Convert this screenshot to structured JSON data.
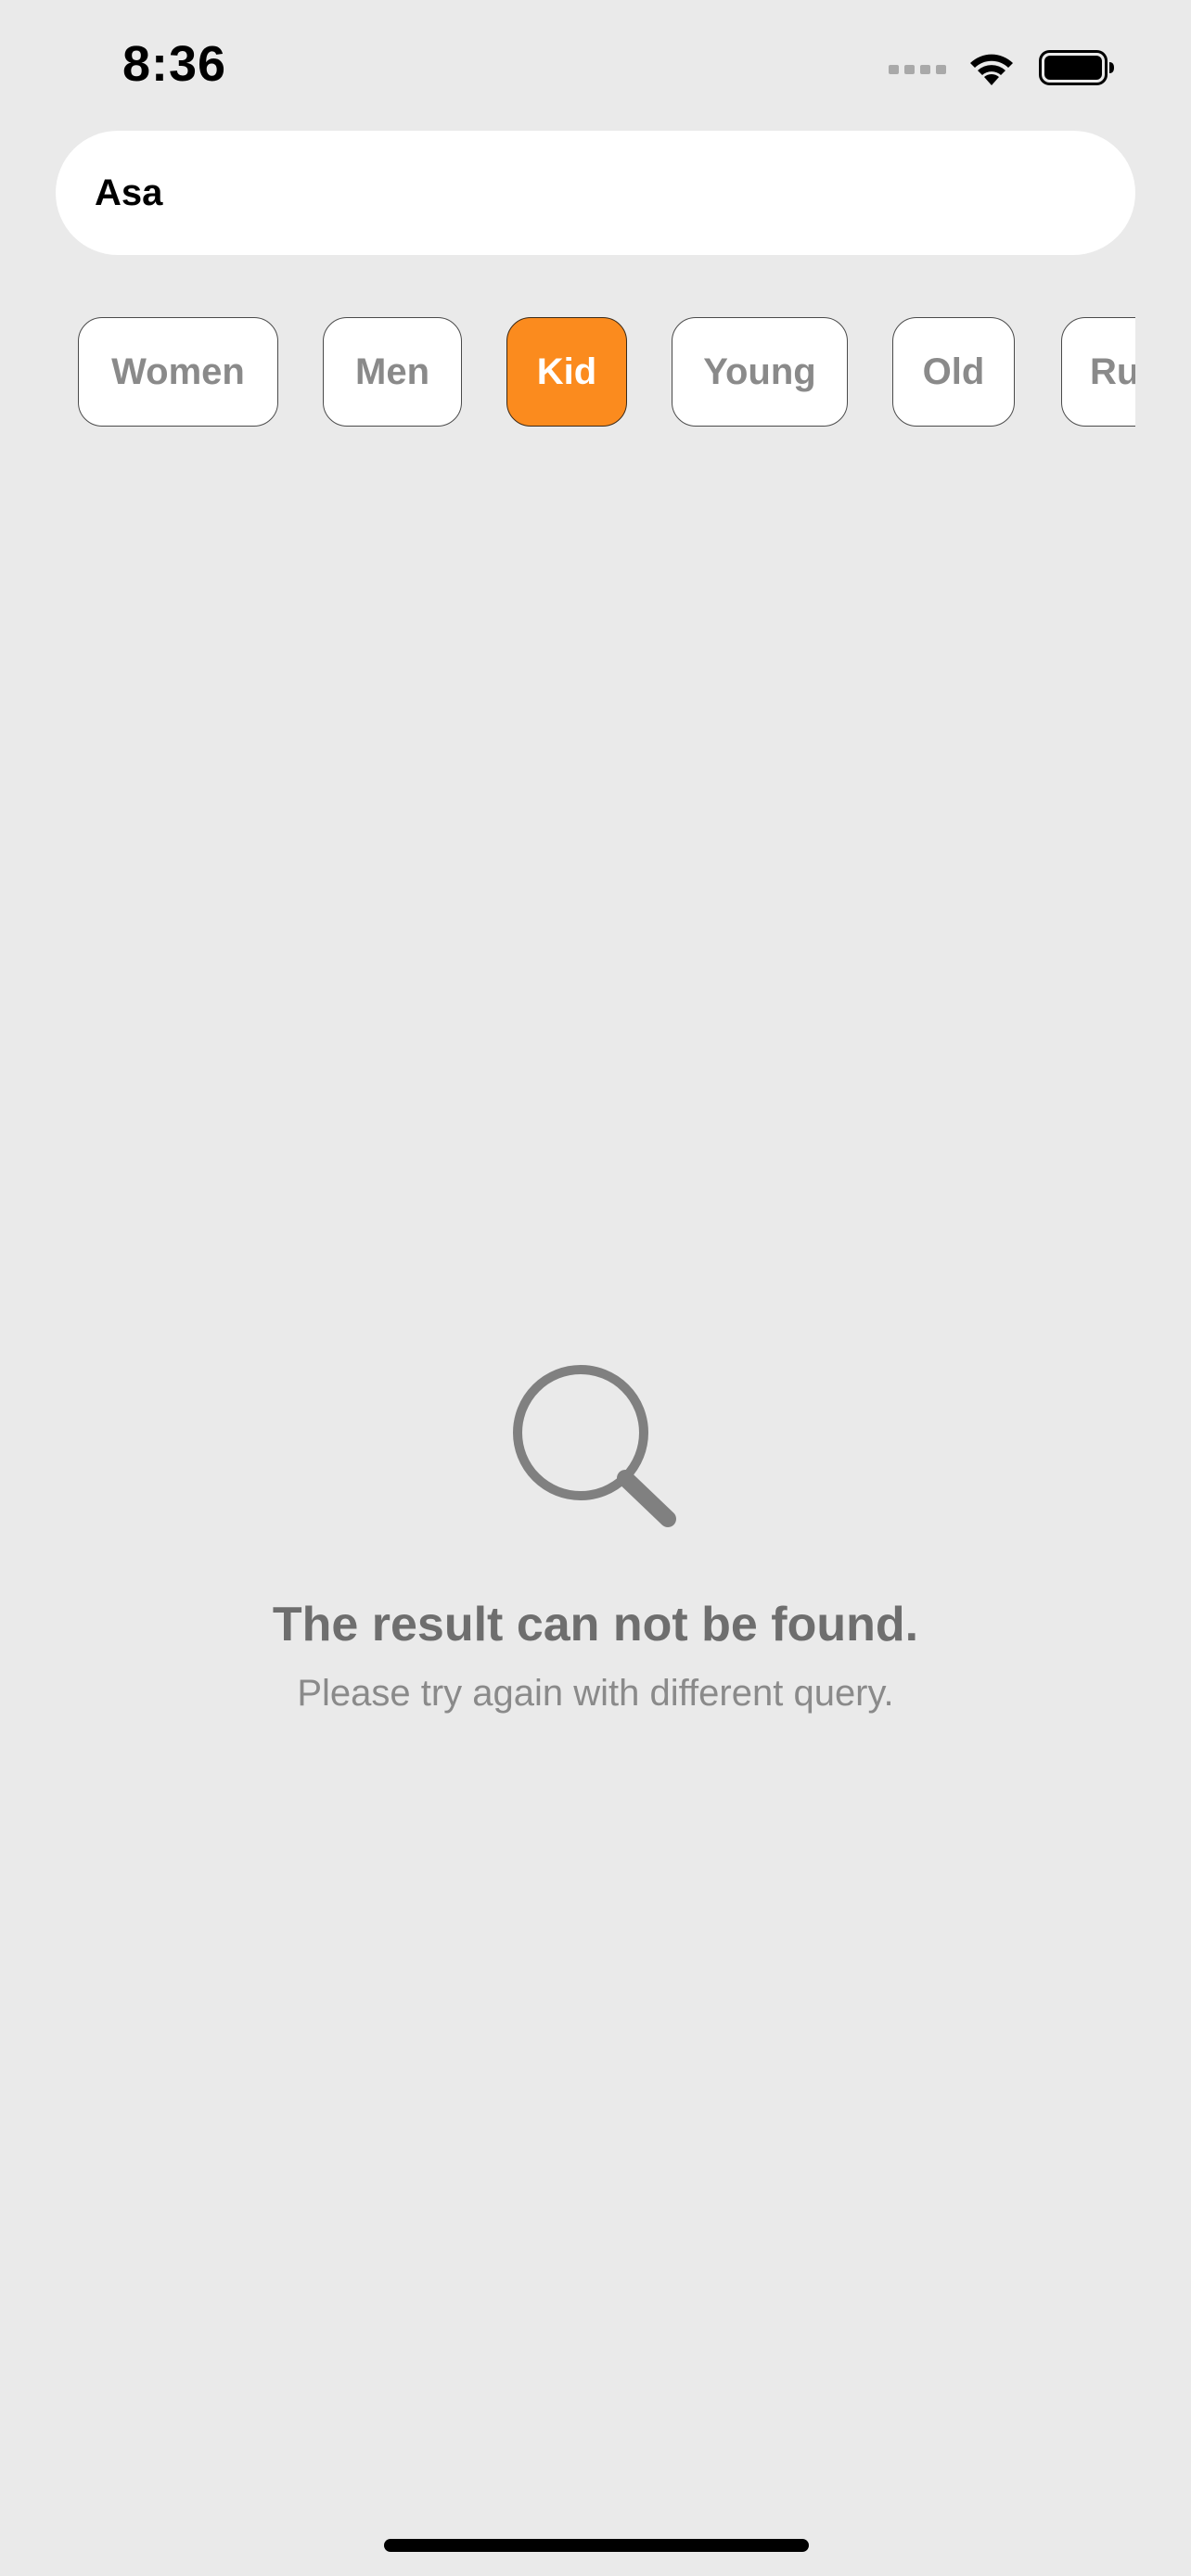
{
  "status_bar": {
    "time": "8:36",
    "icons": [
      "cellular-signal-icon",
      "wifi-icon",
      "battery-icon"
    ]
  },
  "search": {
    "value": "Asa"
  },
  "filters": {
    "chips": [
      {
        "label": "Women",
        "selected": false
      },
      {
        "label": "Men",
        "selected": false
      },
      {
        "label": "Kid",
        "selected": true
      },
      {
        "label": "Young",
        "selected": false
      },
      {
        "label": "Old",
        "selected": false
      },
      {
        "label": "Ru",
        "selected": false
      }
    ]
  },
  "empty_state": {
    "icon": "magnifying-glass-icon",
    "title": "The result can not be found.",
    "subtitle": "Please try again with different query."
  },
  "colors": {
    "background": "#EAEAEA",
    "accent": "#FB8B1E",
    "chip_text": "#8A8A8A",
    "title_text": "#6E6E6E"
  }
}
